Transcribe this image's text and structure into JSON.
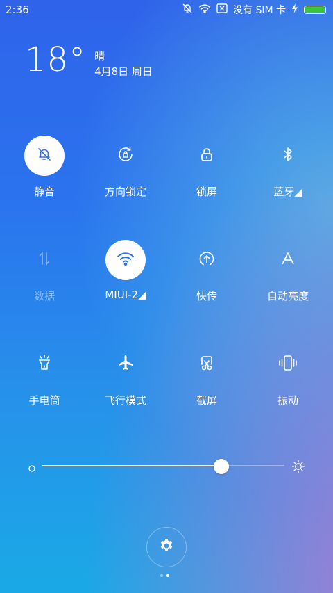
{
  "status_bar": {
    "time": "2:36",
    "carrier": "没有 SIM 卡",
    "icons": [
      "bell-muted-icon",
      "wifi-icon",
      "sim-error-icon",
      "charging-icon",
      "battery-icon"
    ],
    "battery_color": "#39c43a"
  },
  "weather": {
    "temperature": "18°",
    "condition": "晴",
    "date": "4月8日 周日"
  },
  "toggles": [
    {
      "label": "静音",
      "icon": "bell-muted-icon",
      "active": true
    },
    {
      "label": "方向锁定",
      "icon": "rotation-lock-icon",
      "active": false
    },
    {
      "label": "锁屏",
      "icon": "lock-icon",
      "active": false
    },
    {
      "label": "蓝牙◢",
      "icon": "bluetooth-icon",
      "active": false
    },
    {
      "label": "数据",
      "icon": "data-arrows-icon",
      "active": false,
      "disabled": true
    },
    {
      "label": "MIUI-2◢",
      "icon": "wifi-icon",
      "active": true
    },
    {
      "label": "快传",
      "icon": "upload-icon",
      "active": false
    },
    {
      "label": "自动亮度",
      "icon": "auto-brightness-icon",
      "active": false
    },
    {
      "label": "手电筒",
      "icon": "flashlight-icon",
      "active": false
    },
    {
      "label": "飞行模式",
      "icon": "airplane-icon",
      "active": false
    },
    {
      "label": "截屏",
      "icon": "screenshot-icon",
      "active": false
    },
    {
      "label": "振动",
      "icon": "vibrate-icon",
      "active": false
    }
  ],
  "brightness": {
    "value": 0.74,
    "min_icon": "brightness-low-icon",
    "max_icon": "brightness-high-icon"
  },
  "settings": {
    "icon": "gear-icon"
  },
  "pager": {
    "count": 2,
    "active_index": 1
  }
}
